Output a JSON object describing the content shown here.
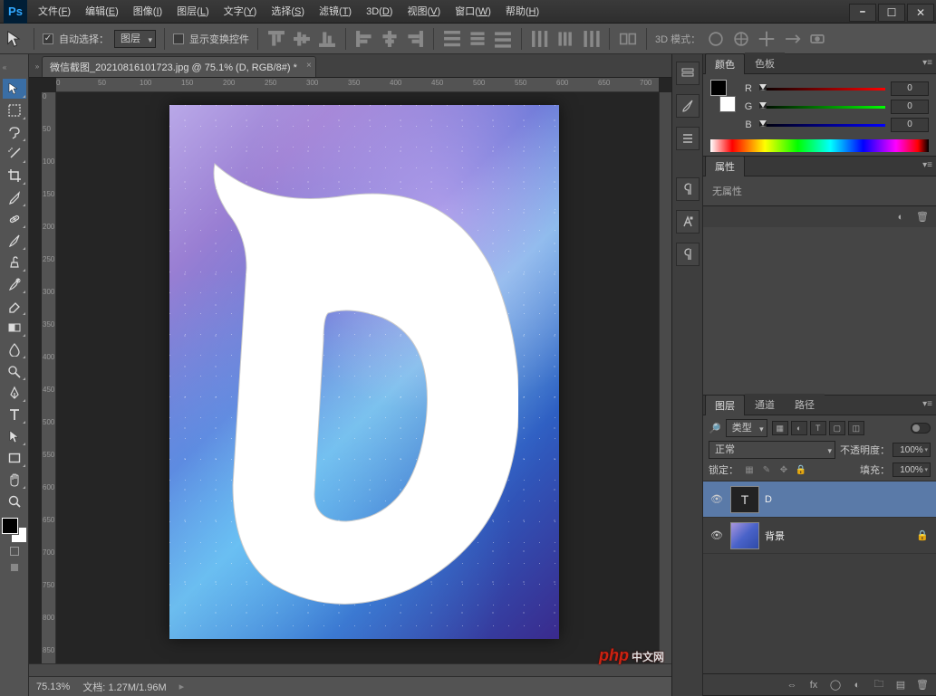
{
  "app": {
    "logo": "Ps"
  },
  "menu": [
    {
      "label": "文件",
      "key": "F"
    },
    {
      "label": "编辑",
      "key": "E"
    },
    {
      "label": "图像",
      "key": "I"
    },
    {
      "label": "图层",
      "key": "L"
    },
    {
      "label": "文字",
      "key": "Y"
    },
    {
      "label": "选择",
      "key": "S"
    },
    {
      "label": "滤镜",
      "key": "T"
    },
    {
      "label": "3D",
      "key": "D"
    },
    {
      "label": "视图",
      "key": "V"
    },
    {
      "label": "窗口",
      "key": "W"
    },
    {
      "label": "帮助",
      "key": "H"
    }
  ],
  "options": {
    "auto_select_label": "自动选择：",
    "auto_select_target": "图层",
    "show_transform_label": "显示变换控件",
    "mode3d_label": "3D 模式："
  },
  "document": {
    "tab_title": "微信截图_20210816101723.jpg @ 75.1% (D, RGB/8#) *",
    "canvas_text": "D"
  },
  "ruler_h": [
    "0",
    "50",
    "100",
    "150",
    "200",
    "250",
    "300",
    "350",
    "400",
    "450",
    "500",
    "550",
    "600",
    "650",
    "700"
  ],
  "ruler_v": [
    "0",
    "50",
    "100",
    "150",
    "200",
    "250",
    "300",
    "350",
    "400",
    "450",
    "500",
    "550",
    "600",
    "650",
    "700",
    "750",
    "800",
    "850"
  ],
  "status": {
    "zoom": "75.13%",
    "doc_label": "文档:",
    "doc_size": "1.27M/1.96M"
  },
  "panels": {
    "color": {
      "tab_color": "颜色",
      "tab_swatch": "色板",
      "r_label": "R",
      "r_val": "0",
      "g_label": "G",
      "g_val": "0",
      "b_label": "B",
      "b_val": "0"
    },
    "properties": {
      "tab": "属性",
      "empty": "无属性"
    },
    "layers": {
      "tab_layers": "图层",
      "tab_channels": "通道",
      "tab_paths": "路径",
      "filter_kind": "类型",
      "blend_mode": "正常",
      "opacity_label": "不透明度：",
      "opacity_value": "100%",
      "lock_label": "锁定：",
      "fill_label": "填充：",
      "fill_value": "100%",
      "items": [
        {
          "name": "D",
          "type": "text",
          "visible": true,
          "locked": false
        },
        {
          "name": "背景",
          "type": "image",
          "visible": true,
          "locked": true
        }
      ]
    }
  },
  "watermark": {
    "brand": "php",
    "suffix": "中文网"
  }
}
